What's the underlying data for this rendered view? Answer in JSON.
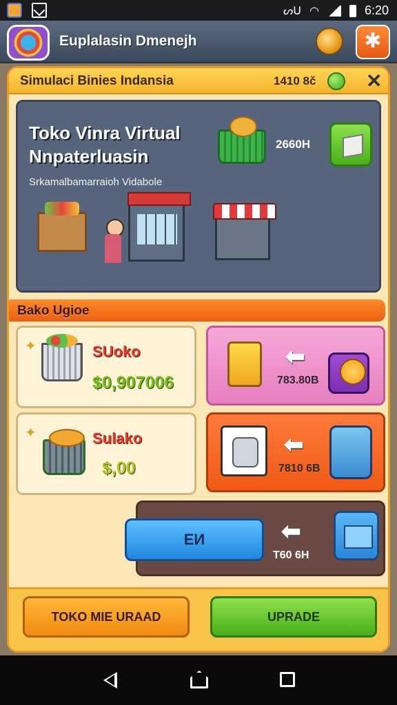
{
  "status_bar": {
    "time": "6:20",
    "glyph": "ᔕᑌ"
  },
  "header": {
    "title": "Euplalasin Dmenejh"
  },
  "panel": {
    "title": "Simulaci Binies Indansia",
    "coins": "1410 8č",
    "close_label": "✕"
  },
  "hero": {
    "title": "Toko Vinra Virtual Nnpaterluasin",
    "subtitle": "Srkamalbamarraioh Vidabole",
    "price": "2660H"
  },
  "section": {
    "label": "Bako Ugioe"
  },
  "cards": [
    {
      "name": "SUoko",
      "price": "$0,907006"
    },
    {
      "name": "Sulako",
      "price": "$,00"
    }
  ],
  "side_cards": [
    {
      "value": "783.80B"
    },
    {
      "value": "7810 6B"
    },
    {
      "value": "T60 6H"
    }
  ],
  "blue_button": {
    "label": "EИ"
  },
  "buttons": {
    "left": "TOKO MIE URAAD",
    "right": "UPRADE"
  },
  "colors": {
    "accent_orange": "#f05a16",
    "accent_green": "#48b01a",
    "panel_bg": "#fbe7b6"
  }
}
